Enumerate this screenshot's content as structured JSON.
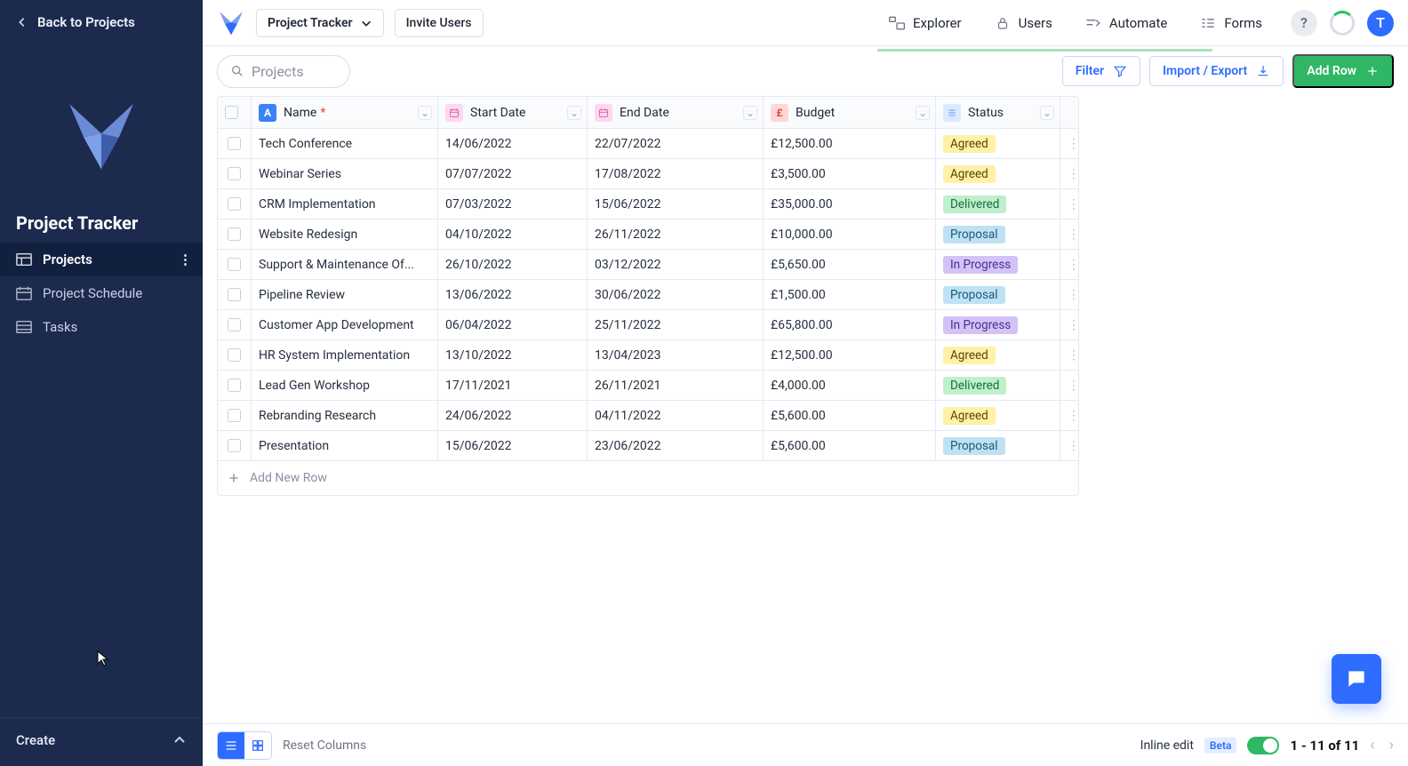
{
  "sidebar": {
    "back_label": "Back to Projects",
    "title": "Project Tracker",
    "create_label": "Create",
    "items": [
      {
        "label": "Projects",
        "active": true
      },
      {
        "label": "Project Schedule",
        "active": false
      },
      {
        "label": "Tasks",
        "active": false
      }
    ]
  },
  "topbar": {
    "brand_dropdown_label": "Project Tracker",
    "invite_label": "Invite Users",
    "links": {
      "explorer": "Explorer",
      "users": "Users",
      "automate": "Automate",
      "forms": "Forms"
    },
    "help_text": "?",
    "avatar_letter": "T"
  },
  "toolbar": {
    "search_placeholder": "Projects",
    "filter_label": "Filter",
    "import_export_label": "Import / Export",
    "add_row_label": "Add Row"
  },
  "table": {
    "columns": {
      "name": "Name",
      "name_required_mark": "*",
      "start_date": "Start Date",
      "end_date": "End Date",
      "budget": "Budget",
      "status": "Status"
    },
    "rows": [
      {
        "name": "Tech Conference",
        "start": "14/06/2022",
        "end": "22/07/2022",
        "budget": "£12,500.00",
        "status": "Agreed"
      },
      {
        "name": "Webinar Series",
        "start": "07/07/2022",
        "end": "17/08/2022",
        "budget": "£3,500.00",
        "status": "Agreed"
      },
      {
        "name": "CRM Implementation",
        "start": "07/03/2022",
        "end": "15/06/2022",
        "budget": "£35,000.00",
        "status": "Delivered"
      },
      {
        "name": "Website Redesign",
        "start": "04/10/2022",
        "end": "26/11/2022",
        "budget": "£10,000.00",
        "status": "Proposal"
      },
      {
        "name": "Support & Maintenance Of...",
        "start": "26/10/2022",
        "end": "03/12/2022",
        "budget": "£5,650.00",
        "status": "In Progress"
      },
      {
        "name": "Pipeline Review",
        "start": "13/06/2022",
        "end": "30/06/2022",
        "budget": "£1,500.00",
        "status": "Proposal"
      },
      {
        "name": "Customer App Development",
        "start": "06/04/2022",
        "end": "25/11/2022",
        "budget": "£65,800.00",
        "status": "In Progress"
      },
      {
        "name": "HR System Implementation",
        "start": "13/10/2022",
        "end": "13/04/2023",
        "budget": "£12,500.00",
        "status": "Agreed"
      },
      {
        "name": "Lead Gen Workshop",
        "start": "17/11/2021",
        "end": "26/11/2021",
        "budget": "£4,000.00",
        "status": "Delivered"
      },
      {
        "name": "Rebranding Research",
        "start": "24/06/2022",
        "end": "04/11/2022",
        "budget": "£5,600.00",
        "status": "Agreed"
      },
      {
        "name": "Presentation",
        "start": "15/06/2022",
        "end": "23/06/2022",
        "budget": "£5,600.00",
        "status": "Proposal"
      }
    ],
    "add_new_row_label": "Add New Row"
  },
  "footer": {
    "reset_label": "Reset Columns",
    "inline_edit_label": "Inline edit",
    "beta_label": "Beta",
    "pager": "1 - 11 of 11"
  },
  "status_style": {
    "Agreed": "agreed",
    "Delivered": "delivered",
    "Proposal": "proposal",
    "In Progress": "inprogress"
  }
}
